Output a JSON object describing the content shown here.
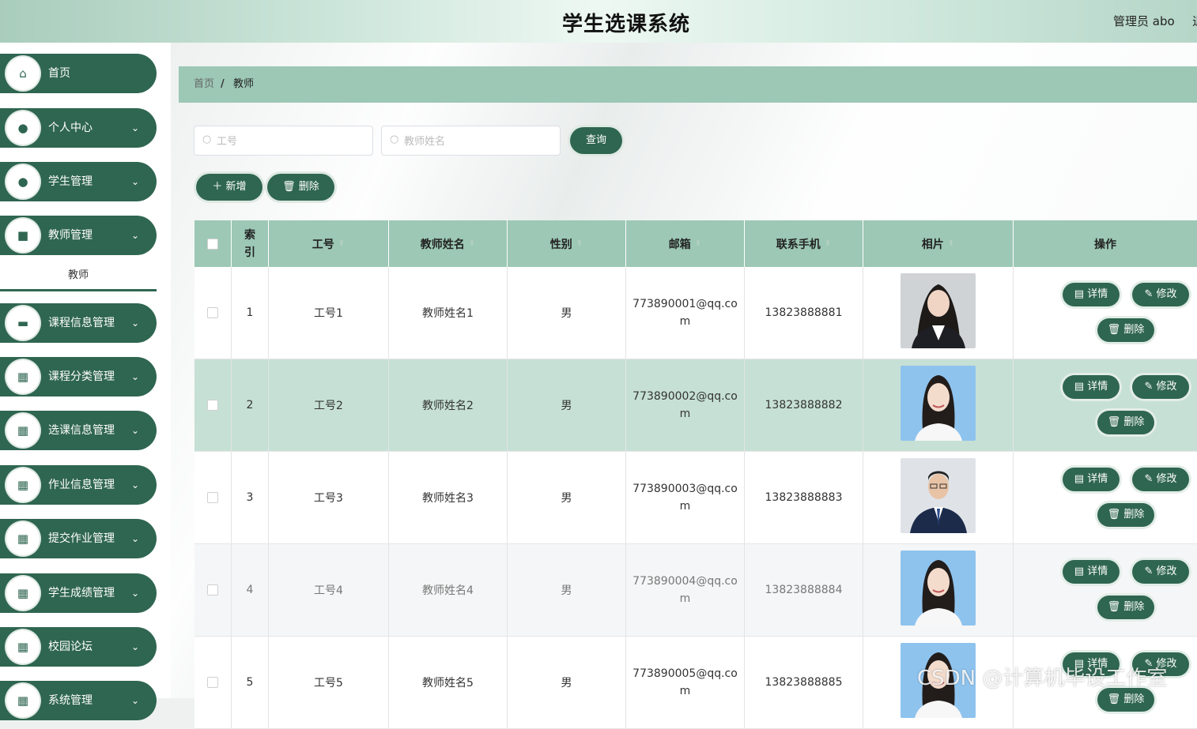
{
  "header": {
    "title": "学生选课系统",
    "user": "管理员 abo",
    "logout": "退"
  },
  "sidebar": {
    "items": [
      {
        "label": "首页",
        "icon": "home-icon",
        "glyph": "⌂",
        "arrow": ""
      },
      {
        "label": "个人中心",
        "icon": "user-icon",
        "glyph": "●",
        "arrow": "⌄"
      },
      {
        "label": "学生管理",
        "icon": "student-icon",
        "glyph": "●",
        "arrow": "⌄"
      },
      {
        "label": "教师管理",
        "icon": "teacher-icon",
        "glyph": "■",
        "arrow": "⌄"
      },
      {
        "label": "课程信息管理",
        "icon": "briefcase-icon",
        "glyph": "▬",
        "arrow": "⌄"
      },
      {
        "label": "课程分类管理",
        "icon": "grid-icon",
        "glyph": "▦",
        "arrow": "⌄"
      },
      {
        "label": "选课信息管理",
        "icon": "grid-icon",
        "glyph": "▦",
        "arrow": "⌄"
      },
      {
        "label": "作业信息管理",
        "icon": "grid-icon",
        "glyph": "▦",
        "arrow": "⌄"
      },
      {
        "label": "提交作业管理",
        "icon": "grid-icon",
        "glyph": "▦",
        "arrow": "⌄"
      },
      {
        "label": "学生成绩管理",
        "icon": "grid-icon",
        "glyph": "▦",
        "arrow": "⌄"
      },
      {
        "label": "校园论坛",
        "icon": "grid-icon",
        "glyph": "▦",
        "arrow": "⌄"
      },
      {
        "label": "系统管理",
        "icon": "grid-icon",
        "glyph": "▦",
        "arrow": "⌄"
      }
    ],
    "submenu_label": "教师"
  },
  "breadcrumb": {
    "home": "首页",
    "separator": "/",
    "current": "教师"
  },
  "search": {
    "id_placeholder": "工号",
    "name_placeholder": "教师姓名",
    "query_label": "查询"
  },
  "toolbar": {
    "add_label": "＋ 新增",
    "delete_label": "🗑 删除"
  },
  "table": {
    "headers": [
      "索引",
      "工号",
      "教师姓名",
      "性别",
      "邮箱",
      "联系手机",
      "相片",
      "操作"
    ],
    "rows": [
      {
        "index": "1",
        "id": "工号1",
        "name": "教师姓名1",
        "gender": "男",
        "email": "773890001@qq.com",
        "phone": "13823888881",
        "photo": "female-dark-suit"
      },
      {
        "index": "2",
        "id": "工号2",
        "name": "教师姓名2",
        "gender": "男",
        "email": "773890002@qq.com",
        "phone": "13823888882",
        "photo": "female-blue-bg"
      },
      {
        "index": "3",
        "id": "工号3",
        "name": "教师姓名3",
        "gender": "男",
        "email": "773890003@qq.com",
        "phone": "13823888883",
        "photo": "male-suit"
      },
      {
        "index": "4",
        "id": "工号4",
        "name": "教师姓名4",
        "gender": "男",
        "email": "773890004@qq.com",
        "phone": "13823888884",
        "photo": "female-blue-bg"
      },
      {
        "index": "5",
        "id": "工号5",
        "name": "教师姓名5",
        "gender": "男",
        "email": "773890005@qq.com",
        "phone": "13823888885",
        "photo": "female-blue-bg"
      }
    ],
    "actions": {
      "detail": "详情",
      "edit": "修改",
      "delete": "删除"
    }
  },
  "watermark": "CSDN @计算机毕设工作室",
  "colors": {
    "primary": "#2f6651",
    "header_bg": "#9cc8b5",
    "row_highlight": "#c6e0d5"
  }
}
